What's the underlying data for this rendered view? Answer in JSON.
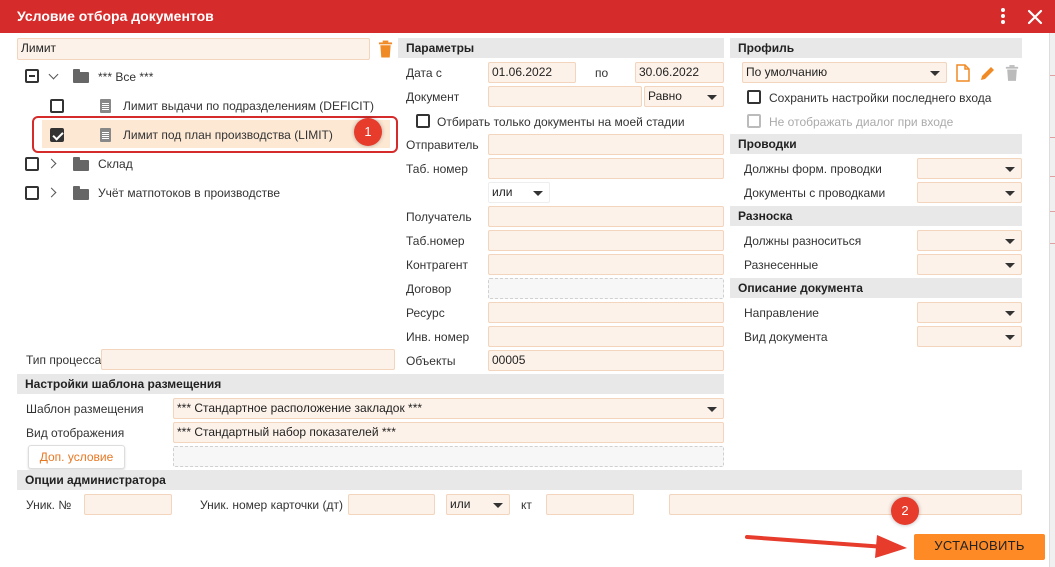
{
  "window": {
    "title": "Условие отбора документов"
  },
  "left": {
    "search_value": "Лимит",
    "tree": {
      "root": "*** Все ***",
      "child1": "Лимит выдачи по подразделениям (DEFICIT)",
      "child2": "Лимит под план производства (LIMIT)",
      "folder2": "Склад",
      "folder3": "Учёт матпотоков в производстве"
    },
    "process_type_label": "Тип процесса"
  },
  "params": {
    "header": "Параметры",
    "date_from_label": "Дата с",
    "date_from": "01.06.2022",
    "to_label": "по",
    "date_to": "30.06.2022",
    "document_label": "Документ",
    "document_mode": "Равно",
    "my_stage_label": "Отбирать только документы на моей стадии",
    "sender_label": "Отправитель",
    "tab_no_label": "Таб. номер",
    "or_value": "или",
    "receiver_label": "Получатель",
    "tab_no2_label": "Таб.номер",
    "counterparty_label": "Контрагент",
    "contract_label": "Договор",
    "resource_label": "Ресурс",
    "inv_no_label": "Инв. номер",
    "objects_label": "Объекты",
    "objects_value": "00005"
  },
  "profile": {
    "header": "Профиль",
    "selected": "По умолчанию",
    "save_last_label": "Сохранить настройки последнего входа",
    "no_dialog_label": "Не отображать диалог при входе"
  },
  "postings": {
    "header": "Проводки",
    "must_form_label": "Должны форм. проводки",
    "docs_with_label": "Документы с проводками"
  },
  "distribution": {
    "header": "Разноска",
    "must_label": "Должны разноситься",
    "done_label": "Разнесенные"
  },
  "doc_desc": {
    "header": "Описание документа",
    "direction_label": "Направление",
    "doc_type_label": "Вид документа"
  },
  "placement": {
    "header": "Настройки шаблона размещения",
    "template_label": "Шаблон размещения",
    "template_value": "*** Стандартное расположение закладок ***",
    "view_label": "Вид отображения",
    "view_value": "*** Стандартный набор показателей ***",
    "extra_button": "Доп. условие"
  },
  "admin": {
    "header": "Опции администратора",
    "unique_no_label": "Уник. №",
    "card_no_label": "Уник. номер карточки (дт)",
    "or_value": "или",
    "kt_label": "кт"
  },
  "actions": {
    "set_button": "УСТАНОВИТЬ"
  },
  "callouts": {
    "one": "1",
    "two": "2"
  },
  "colors": {
    "titlebar": "#d52b2b",
    "accent": "#fd8a25",
    "field_bg": "#fdf2e9",
    "callout": "#e73b2c"
  }
}
